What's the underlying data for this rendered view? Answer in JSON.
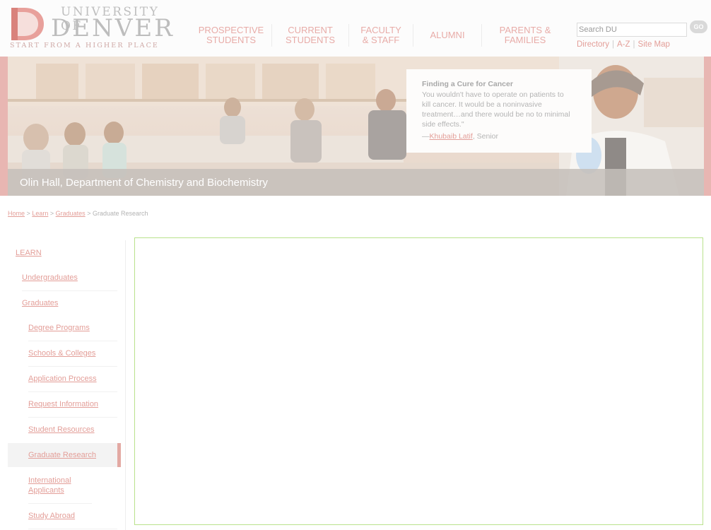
{
  "header": {
    "logo": {
      "line1": "UNIVERSITY OF",
      "line2": "DENVER",
      "tagline": "START FROM A HIGHER PLACE"
    },
    "nav": [
      {
        "line1": "PROSPECTIVE",
        "line2": "STUDENTS"
      },
      {
        "line1": "CURRENT",
        "line2": "STUDENTS"
      },
      {
        "line1": "FACULTY",
        "line2": "& STAFF"
      },
      {
        "line1": "ALUMNI",
        "line2": ""
      },
      {
        "line1": "PARENTS &",
        "line2": "FAMILIES"
      }
    ],
    "search": {
      "placeholder": "Search DU",
      "go_label": "GO"
    },
    "util_links": [
      "Directory",
      "A-Z",
      "Site Map"
    ]
  },
  "hero": {
    "caption": "Olin Hall, Department of Chemistry and Biochemistry",
    "quote": {
      "title": "Finding a Cure for Cancer",
      "body": "You wouldn't have to operate on patients to kill cancer. It would be a noninvasive treatment…and there would be no to minimal side effects.\"",
      "attr_prefix": "—",
      "attr_name": "Khubaib Latif",
      "attr_suffix": ", Senior"
    }
  },
  "breadcrumb": {
    "links": [
      "Home",
      "Learn",
      "Graduates"
    ],
    "separator": ">",
    "current": "Graduate Research"
  },
  "sidebar": {
    "heading": "LEARN",
    "items": [
      "Undergraduates",
      "Graduates",
      "Degree Programs",
      "Schools & Colleges",
      "Application Process",
      "Request Information",
      "Student Resources",
      "Graduate Research",
      "International Applicants",
      "Study Abroad"
    ],
    "active": "Graduate Research"
  },
  "colors": {
    "brand_red": "#e39e98",
    "nav_text": "#e8aca8",
    "frame_border": "#b9e28c"
  }
}
